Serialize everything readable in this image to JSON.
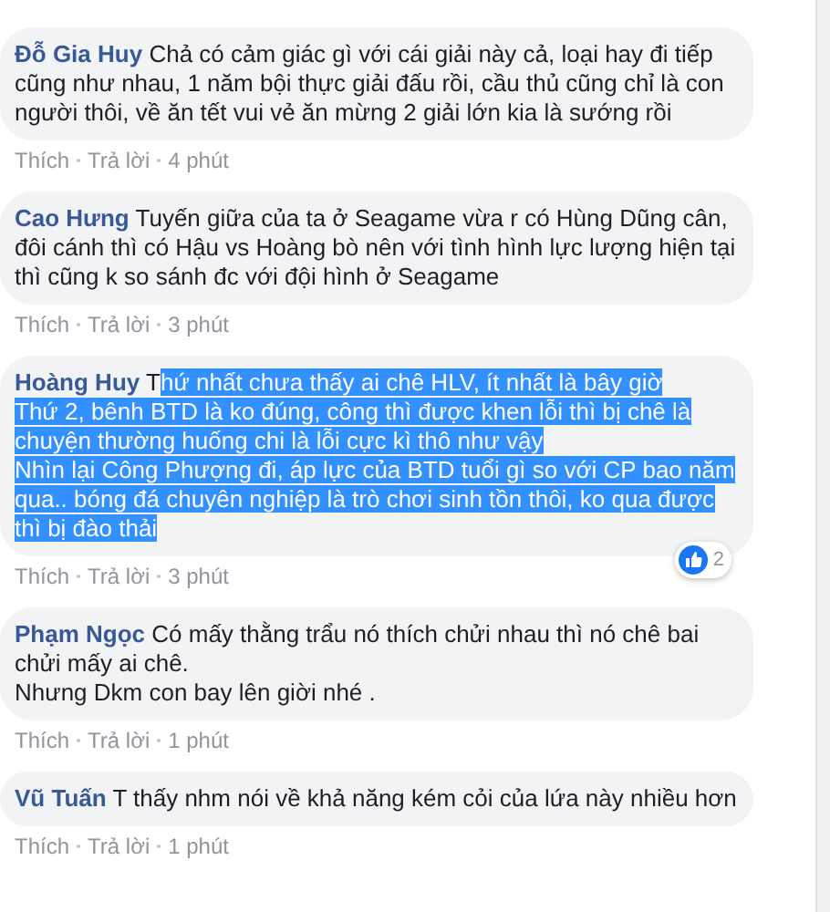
{
  "comments": [
    {
      "author": "Đỗ Gia Huy",
      "segments": [
        {
          "text": "Chả có cảm giác gì với cái giải này cả, loại hay đi tiếp cũng như nhau, 1 năm bội thực giải đấu rồi, cầu thủ cũng chỉ là con người thôi, về ăn tết vui vẻ ăn mừng 2 giải lớn kia là sướng rồi",
          "highlighted": false
        }
      ],
      "actions": [
        "Thích",
        "Trả lời"
      ],
      "time": "4 phút"
    },
    {
      "author": "Cao Hưng",
      "segments": [
        {
          "text": "Tuyến giữa của ta ở Seagame vừa r có Hùng Dũng cân, đôi cánh thì có Hậu vs Hoàng bò nên với tình hình lực lượng hiện tại thì cũng k so sánh đc với đội hình ở Seagame",
          "highlighted": false
        }
      ],
      "actions": [
        "Thích",
        "Trả lời"
      ],
      "time": "3 phút"
    },
    {
      "author": "Hoàng Huy",
      "segments": [
        {
          "text": "T",
          "highlighted": false
        },
        {
          "text": "hứ nhất chưa thấy ai chê HLV, ít nhất là bây giờ\nThứ 2, bênh BTD là ko đúng, công thì được khen lỗi thì bị chê là chuyện thường huống chi là lỗi cực kì thô như vậy\nNhìn lại Công Phượng đi, áp lực của BTD tuổi gì so với CP bao năm qua.. bóng đá chuyên nghiệp là trò chơi sinh tồn thôi, ko qua được thì bị đào thải",
          "highlighted": true
        }
      ],
      "reaction": {
        "count": "2"
      },
      "actions": [
        "Thích",
        "Trả lời"
      ],
      "time": "3 phút"
    },
    {
      "author": "Phạm Ngọc",
      "segments": [
        {
          "text": "Có mấy thằng trẩu nó thích chửi nhau thì nó chê bai chửi mấy ai chê.\nNhưng Dkm con bay lên giời nhé .",
          "highlighted": false
        }
      ],
      "actions": [
        "Thích",
        "Trả lời"
      ],
      "time": "1 phút"
    },
    {
      "author": "Vũ Tuấn",
      "segments": [
        {
          "text": "T thấy nhm nói về khả năng kém cỏi của lứa này nhiều hơn",
          "highlighted": false
        }
      ],
      "actions": [
        "Thích",
        "Trả lời"
      ],
      "time": "1 phút"
    }
  ]
}
